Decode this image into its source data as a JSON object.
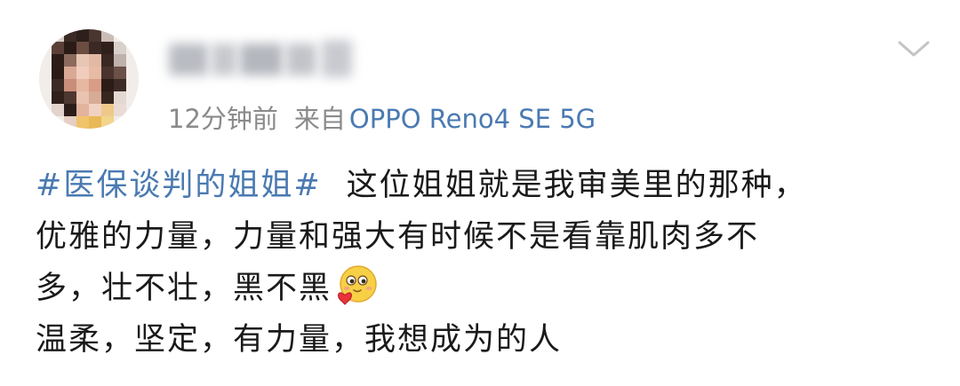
{
  "post": {
    "author_avatar": "blurred-profile-photo",
    "author_name_visible": false,
    "time": "12分钟前",
    "source_prefix": "来自",
    "device": "OPPO Reno4 SE 5G",
    "menu_icon": "chevron-down-icon",
    "hashtag": "#医保谈判的姐姐#",
    "lines": [
      "这位姐姐就是我审美里的那种，",
      "优雅的力量，力量和强大有时候不是看靠肌肉多不",
      "多，壮不壮，黑不黑",
      "温柔，坚定，有力量，我想成为的人"
    ],
    "emoji": "hug-emoji-with-heart",
    "colors": {
      "link": "#4a7ab2",
      "text": "#1a1a1a",
      "meta": "#8a8a8a"
    }
  }
}
